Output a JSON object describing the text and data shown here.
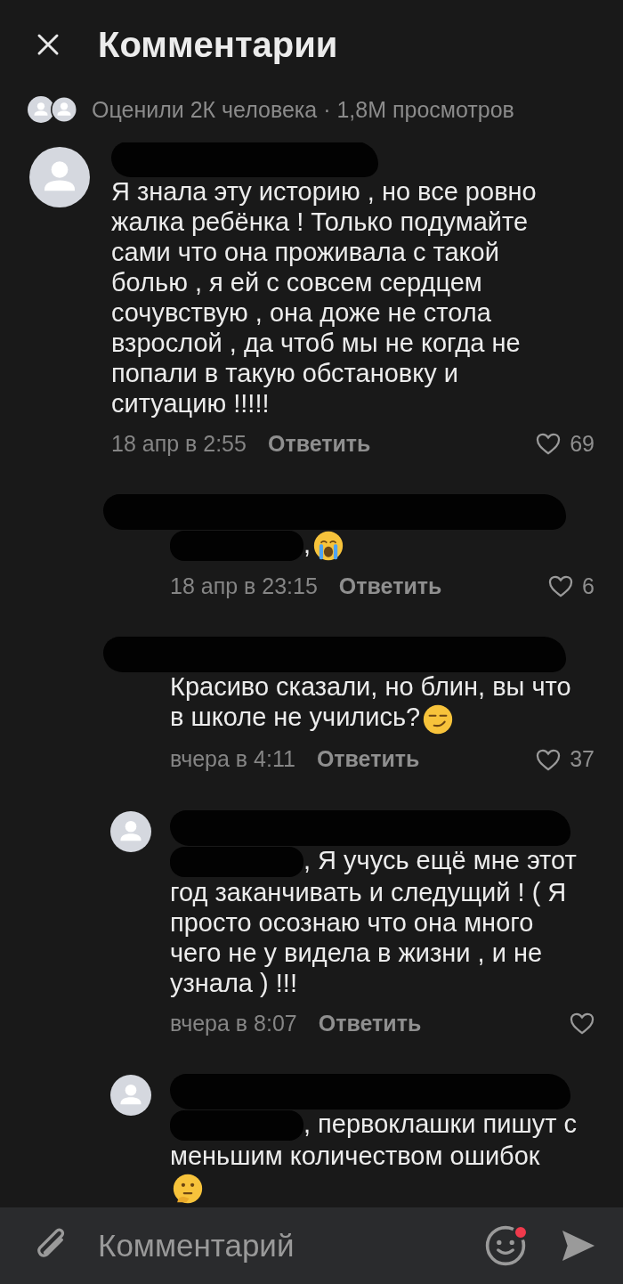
{
  "header": {
    "title": "Комментарии",
    "stats": "Оценили 2К человека · 1,8М просмотров"
  },
  "comments": [
    {
      "kind": "comment",
      "avatar": true,
      "author_hidden": true,
      "parts": [
        {
          "kind": "text",
          "text": "Я знала эту историю , но все ровно жалка ребёнка ! Только подумайте сами что она проживала с такой болью , я ей с совсем сердцем сочувствую , она доже не стола взрослой , да чтоб мы не когда не попали в такую обстановку и ситуацию !!!!!"
        }
      ],
      "time": "18 апр в 2:55",
      "reply": "Ответить",
      "likes": "69"
    },
    {
      "kind": "reply",
      "avatar": false,
      "author_hidden": true,
      "parts": [
        {
          "kind": "redacted"
        },
        {
          "kind": "text",
          "text": ","
        },
        {
          "kind": "crying"
        }
      ],
      "time": "18 апр в 23:15",
      "reply": "Ответить",
      "likes": "6"
    },
    {
      "kind": "reply",
      "avatar": false,
      "author_hidden": true,
      "parts": [
        {
          "kind": "text",
          "text": "Красиво сказали, но блин, вы что"
        },
        {
          "kind": "break"
        },
        {
          "kind": "text",
          "text": "в школе не учились?"
        },
        {
          "kind": "smirk"
        }
      ],
      "time": "вчера в 4:11",
      "reply": "Ответить",
      "likes": "37"
    },
    {
      "kind": "reply",
      "avatar": true,
      "author_hidden": true,
      "parts": [
        {
          "kind": "redacted"
        },
        {
          "kind": "text",
          "text": ", Я учусь ещё мне этот"
        },
        {
          "kind": "break"
        },
        {
          "kind": "text",
          "text": "год заканчивать и следущий ! ( Я просто осознаю что она много чего не у видела в жизни , и не узнала ) !!!"
        }
      ],
      "time": "вчера в 8:07",
      "reply": "Ответить"
    },
    {
      "kind": "reply",
      "avatar": true,
      "author_hidden": true,
      "parts": [
        {
          "kind": "redacted"
        },
        {
          "kind": "text",
          "text": ", первоклашки пишут с"
        },
        {
          "kind": "break"
        },
        {
          "kind": "text",
          "text": "меньшим количеством ошибок"
        },
        {
          "kind": "break"
        },
        {
          "kind": "thinking"
        }
      ]
    }
  ],
  "composer": {
    "placeholder": "Комментарий",
    "emoji_badge": true
  }
}
